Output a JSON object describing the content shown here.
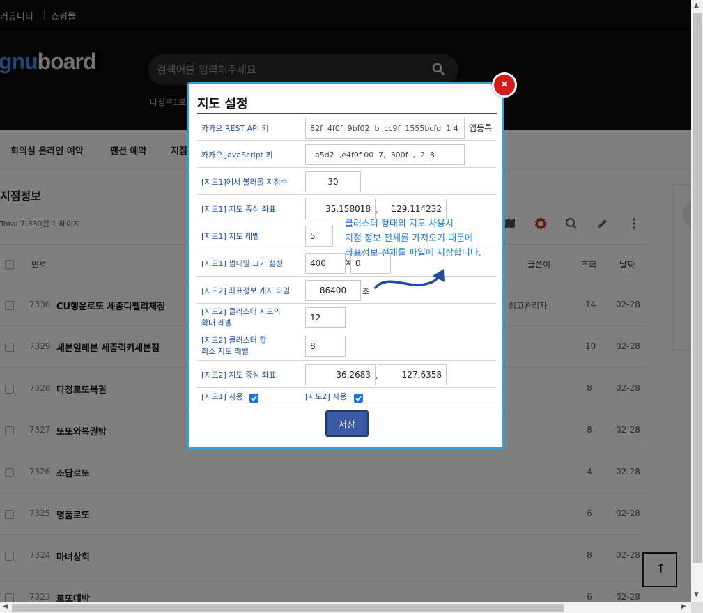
{
  "colors": {
    "accent": "#2ba3e3",
    "close": "#d51a1a",
    "label": "#1f4f9c",
    "note": "#1f7fd6",
    "save": "#3a5aa8"
  },
  "topbar": {
    "community": "커뮤니티",
    "shop": "쇼핑몰"
  },
  "header": {
    "logo_part1": "gnu",
    "logo_part2": "board",
    "search_placeholder": "검색어를 입력해주세요",
    "popular": "나성복1로"
  },
  "nav": {
    "items": [
      "회의실 온라인 예약",
      "팬션 예약",
      "지점"
    ]
  },
  "board": {
    "title": "지점정보",
    "total": "Total 7,330건 1 페이지",
    "headers": {
      "num": "번호",
      "author": "글쓴이",
      "hits": "조회",
      "date": "날짜"
    },
    "rows": [
      {
        "num": "7330",
        "subject": "CU행운로또 세종디펠리체점",
        "author": "최고관리자",
        "hits": "14",
        "date": "02-28"
      },
      {
        "num": "7329",
        "subject": "세븐일레븐 세종럭키세븐점",
        "author": "",
        "hits": "10",
        "date": "02-28"
      },
      {
        "num": "7328",
        "subject": "다정로또복권",
        "author": "",
        "hits": "8",
        "date": "02-28"
      },
      {
        "num": "7327",
        "subject": "또또와복권방",
        "author": "",
        "hits": "8",
        "date": "02-28"
      },
      {
        "num": "7326",
        "subject": "소담로또",
        "author": "",
        "hits": "4",
        "date": "02-28"
      },
      {
        "num": "7325",
        "subject": "명품로또",
        "author": "",
        "hits": "6",
        "date": "02-28"
      },
      {
        "num": "7324",
        "subject": "마녀상회",
        "author": "",
        "hits": "8",
        "date": "02-28"
      },
      {
        "num": "7323",
        "subject": "로또대박",
        "author": "",
        "hits": "6",
        "date": "02-28"
      }
    ]
  },
  "modal": {
    "title": "지도 설정",
    "close_label": "×",
    "rest_api_label": "카카오 REST API 키",
    "rest_api_value": "82f  4f0f  9bf02  b  cc9f  1555bcfd  1 4",
    "app_register": "앱등록",
    "js_key_label": "카카오 JavaScript 키",
    "js_key_value": "  a5d2  ,e4f0f 00  7,  300f  ,  2  8",
    "map1_count_label": "[지도1]에서 불러올 지점수",
    "map1_count_value": "30",
    "map1_center_label": "[지도1] 지도 중심 좌표",
    "map1_center_lat": "35.158018",
    "map1_center_lng": "129.114232",
    "comma": ",",
    "map1_level_label": "[지도1] 지도 레벨",
    "map1_level_value": "5",
    "thumb_size_label": "[지도1] 썸내일 크기 설정",
    "thumb_w": "400",
    "x_sep": "X",
    "thumb_h": "0",
    "cache_label": "[지도2] 좌표정보 캐시 타임",
    "cache_value": "86400",
    "cache_unit": "초",
    "cluster_max_label_1": "[지도2] 클러스터 지도의",
    "cluster_max_label_2": "확대 레벨",
    "cluster_max_value": "12",
    "cluster_min_label_1": "[지도2] 클러스터 할",
    "cluster_min_label_2": "최소 지도 레벨",
    "cluster_min_value": "8",
    "map2_center_label": "[지도2] 지도 중심 좌표",
    "map2_center_lat": "36.2683",
    "map2_center_lng": "127.6358",
    "map1_use_label": "[지도1] 사용",
    "map2_use_label": "[지도2] 사용",
    "save_label": "저장",
    "note_lines": [
      "클러스터 형태의 지도 사용시",
      "지점 정보 전체를 가져오기 때문에",
      "좌표정보 전체를 파일에 저장합니다."
    ]
  }
}
